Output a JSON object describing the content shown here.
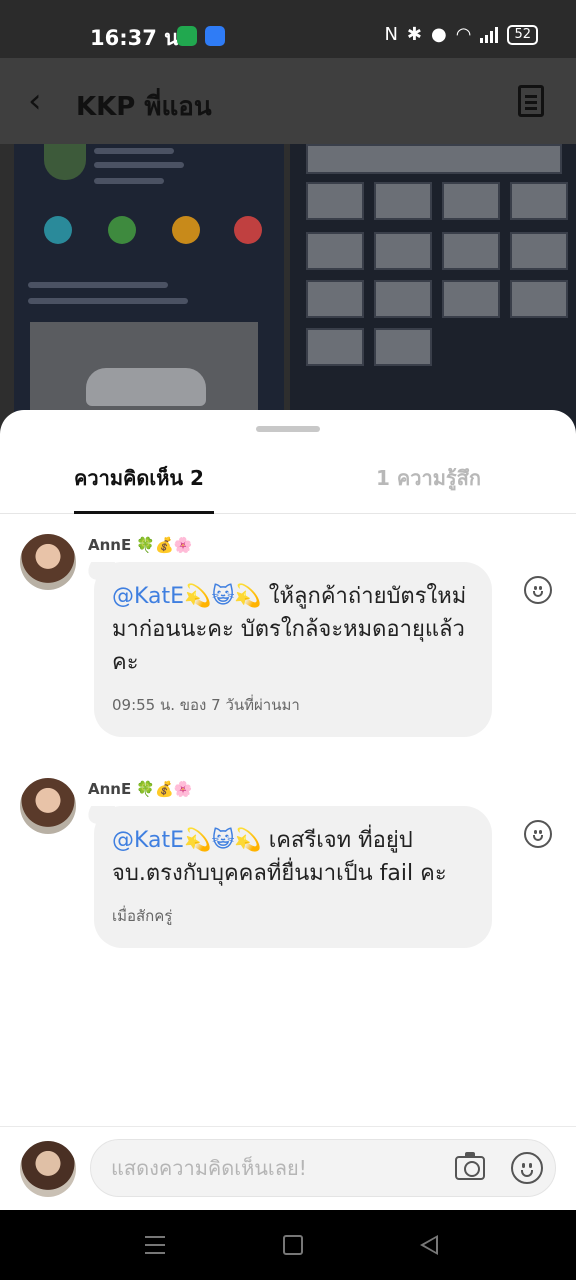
{
  "status_bar": {
    "time": "16:37 น.",
    "battery": "52",
    "icons": [
      "nfc-icon",
      "bluetooth-icon",
      "location-icon",
      "wifi-icon",
      "volte-icon",
      "signal-icon",
      "battery-icon"
    ]
  },
  "header": {
    "title": "KKP พี่แอน"
  },
  "tabs": {
    "comments_label": "ความคิดเห็น 2",
    "reactions_label": "1 ความรู้สึก"
  },
  "comments": [
    {
      "author": "AnnE 🍀💰🌸",
      "mention": "@KatE💫😺💫",
      "text": " ให้ลูกค้าถ่ายบัตรใหม่มาก่อนนะคะ บัตรใกล้จะหมดอายุแล้วคะ",
      "time": "09:55 น. ของ 7 วันที่ผ่านมา"
    },
    {
      "author": "AnnE 🍀💰🌸",
      "mention": "@KatE💫😺💫",
      "text": " เคสรีเจท ที่อยู่ปจบ.ตรงกับบุคคลที่ยื่นมาเป็น fail คะ",
      "time": "เมื่อสักครู่"
    }
  ],
  "composer": {
    "placeholder": "แสดงความคิดเห็นเลย!"
  },
  "colors": {
    "mention": "#3f7fe0",
    "bubble": "#f1f1f1",
    "active_tab": "#111111",
    "inactive_tab": "#b8b8b8"
  }
}
